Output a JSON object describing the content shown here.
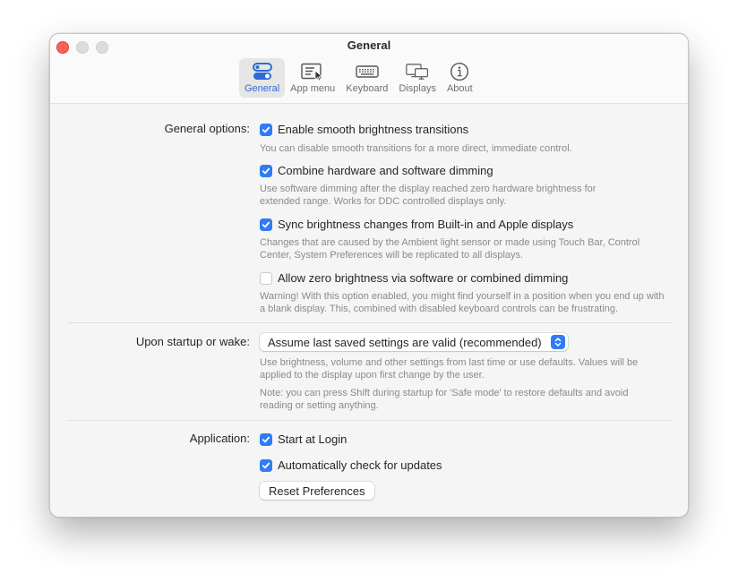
{
  "window": {
    "title": "General",
    "controls": [
      "close",
      "minimize",
      "maximize"
    ]
  },
  "toolbar": {
    "accent": "#2f6bd8",
    "tabs": [
      {
        "label": "General",
        "icon": "toggles-icon",
        "active": true
      },
      {
        "label": "App menu",
        "icon": "app-menu-icon",
        "active": false
      },
      {
        "label": "Keyboard",
        "icon": "keyboard-icon",
        "active": false
      },
      {
        "label": "Displays",
        "icon": "displays-icon",
        "active": false
      },
      {
        "label": "About",
        "icon": "info-icon",
        "active": false
      }
    ]
  },
  "general_options": {
    "label": "General options:",
    "options": [
      {
        "label": "Enable smooth brightness transitions",
        "checked": true,
        "description": "You can disable smooth transitions for a more direct, immediate control."
      },
      {
        "label": "Combine hardware and software dimming",
        "checked": true,
        "description": "Use software dimming after the display reached zero hardware brightness for extended range. Works for DDC controlled displays only."
      },
      {
        "label": "Sync brightness changes from Built-in and Apple displays",
        "checked": true,
        "description": "Changes that are caused by the Ambient light sensor or made using Touch Bar, Control Center, System Preferences will be replicated to all displays."
      },
      {
        "label": "Allow zero brightness via software or combined dimming",
        "checked": false,
        "description": "Warning! With this option enabled, you might find yourself in a position when you end up with a blank display. This, combined with disabled keyboard controls can be frustrating."
      }
    ]
  },
  "startup": {
    "label": "Upon startup or wake:",
    "selected": "Assume last saved settings are valid (recommended)",
    "description": "Use brightness, volume and other settings from last time or use defaults. Values will be applied to the display upon first change by the user.",
    "note": "Note: you can press Shift during startup for 'Safe mode' to restore defaults and avoid reading or setting anything."
  },
  "application": {
    "label": "Application:",
    "options": [
      {
        "label": "Start at Login",
        "checked": true
      },
      {
        "label": "Automatically check for updates",
        "checked": true
      }
    ],
    "reset_button": "Reset Preferences"
  }
}
